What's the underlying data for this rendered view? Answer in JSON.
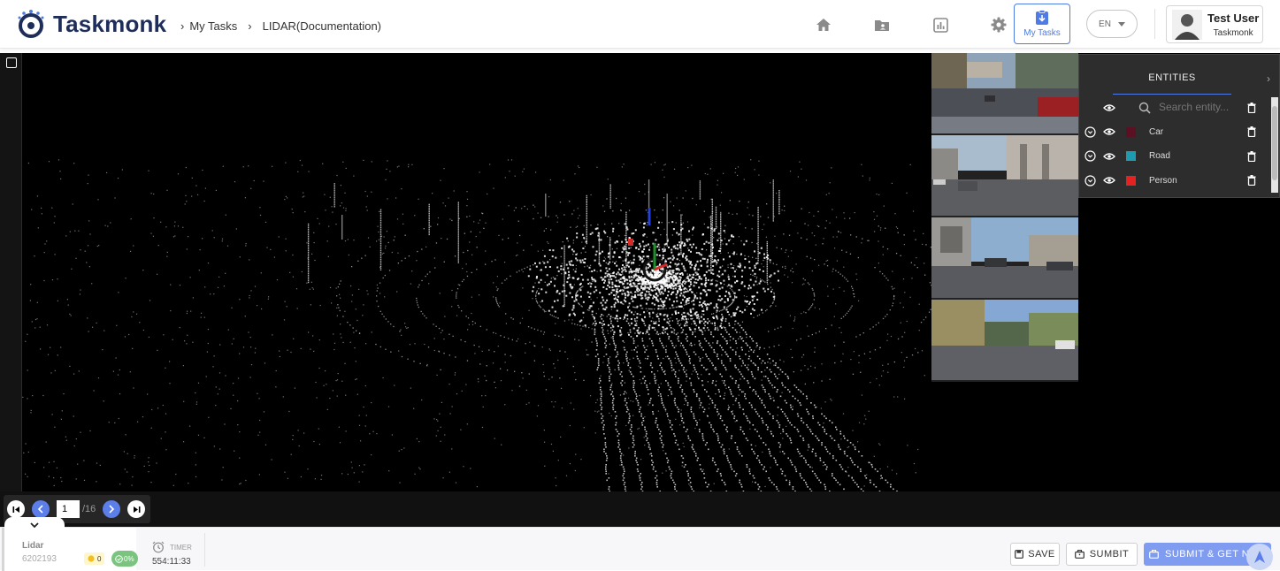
{
  "app": {
    "brand": "Taskmonk"
  },
  "breadcrumb": {
    "item1": "My Tasks",
    "item2": "LIDAR(Documentation)"
  },
  "nav": {
    "icons": [
      "home-icon",
      "folder-user-icon",
      "chart-icon",
      "gear-icon"
    ],
    "mytasks_label": "My Tasks",
    "lang": "EN"
  },
  "user": {
    "name": "Test User",
    "org": "Taskmonk"
  },
  "frame_nav": {
    "current": "1",
    "total": "/16"
  },
  "entities": {
    "title": "ENTITIES",
    "search_placeholder": "Search entity...",
    "items": [
      {
        "label": "Car",
        "color": "#5c1024"
      },
      {
        "label": "Road",
        "color": "#1e9bb0"
      },
      {
        "label": "Person",
        "color": "#e52222"
      }
    ]
  },
  "footer": {
    "title": "Lidar",
    "id": "6202193",
    "badge_count": "0",
    "badge_progress": "0%",
    "timer_label": "TIMER",
    "timer_value": "554:11:33",
    "save": "SAVE",
    "submit": "SUMBIT",
    "submit_next": "SUBMIT & GET NEXT"
  },
  "colors": {
    "accent": "#4e7be6",
    "brand": "#1f2d5a"
  }
}
